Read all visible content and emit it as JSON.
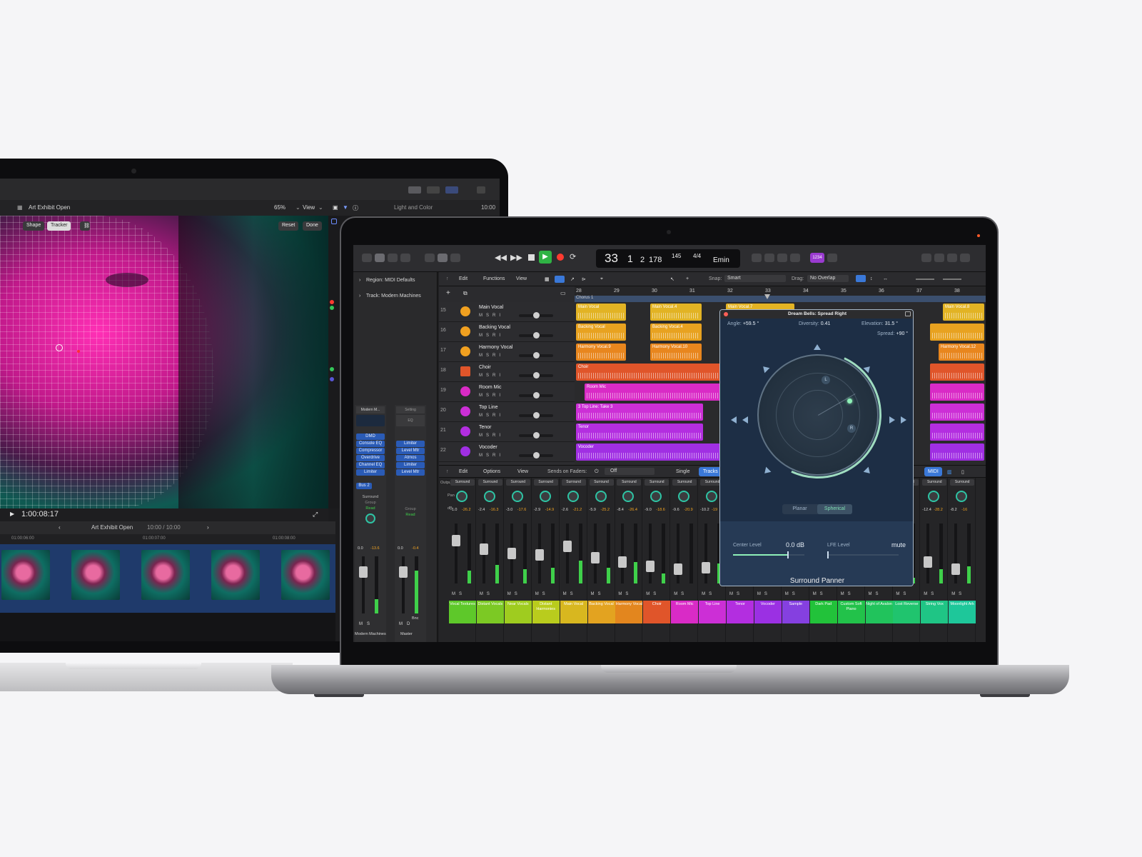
{
  "final_cut": {
    "project_title": "Art Exhibit Open",
    "zoom": "65%",
    "view_menu": "View",
    "inspector_title": "Light and Color",
    "inspector_time": "10:00",
    "shape_tab": "Shape",
    "tracker_tab": "Tracker",
    "reset_button": "Reset",
    "done_button": "Done",
    "timecode": "1:00:08:17",
    "timeline_project": "Art Exhibit Open",
    "timeline_duration": "10:00 / 10:00",
    "ruler_marks": [
      "01:00:06:00",
      "01:00:07:00",
      "01:00:08:00"
    ]
  },
  "logic": {
    "lcd": {
      "bar": "33",
      "beat": "1",
      "div": "2",
      "tick": "178",
      "tempo": "145",
      "signature": "4/4",
      "key": "Emin"
    },
    "cpu_badge": "1234",
    "inspector": {
      "region": "Region: MIDI Defaults",
      "track": "Track: Modern Machines"
    },
    "tracks_menu": {
      "edit": "Edit",
      "functions": "Functions",
      "view": "View",
      "snap_label": "Snap:",
      "snap_value": "Smart",
      "drag_label": "Drag:",
      "drag_value": "No Overlap"
    },
    "ruler": [
      "28",
      "29",
      "30",
      "31",
      "32",
      "33",
      "34",
      "35",
      "36",
      "37",
      "38"
    ],
    "marker": "Chorus 1",
    "tracks": [
      {
        "num": "15",
        "name": "Main Vocal"
      },
      {
        "num": "16",
        "name": "Backing Vocal"
      },
      {
        "num": "17",
        "name": "Harmony Vocal"
      },
      {
        "num": "18",
        "name": "Choir"
      },
      {
        "num": "19",
        "name": "Room Mic"
      },
      {
        "num": "20",
        "name": "Top Line"
      },
      {
        "num": "21",
        "name": "Tenor"
      },
      {
        "num": "22",
        "name": "Vocoder"
      }
    ],
    "regions": [
      {
        "label": "Main Vocal",
        "color": "#e2b324"
      },
      {
        "label": "Main Vocal.4",
        "color": "#e2b324"
      },
      {
        "label": "Main Vocal.7",
        "color": "#e2b324"
      },
      {
        "label": "Main Vocal.8",
        "color": "#e2b324"
      },
      {
        "label": "Backing Vocal",
        "color": "#e8a220"
      },
      {
        "label": "Backing Vocal.4",
        "color": "#e8a220"
      },
      {
        "label": "Harmony Vocal.9",
        "color": "#e8861e"
      },
      {
        "label": "Harmony Vocal.10",
        "color": "#e8861e"
      },
      {
        "label": "Harmony Vocal.12",
        "color": "#e8861e"
      },
      {
        "label": "Choir",
        "color": "#e0552a"
      },
      {
        "label": "Room Mic",
        "color": "#d92bc6"
      },
      {
        "label": "3  Top Line: Take 3",
        "color": "#cc2fd6"
      },
      {
        "label": "Tenor",
        "color": "#b32ee0"
      },
      {
        "label": "Vocoder",
        "color": "#a02fe3"
      }
    ],
    "strip_plugins_left": [
      "DMD",
      "Console EQ",
      "Compressor",
      "Overdrive",
      "Channel EQ",
      "Limiter"
    ],
    "strip_plugins_right": [
      "Limiter",
      "Level Mtr",
      "Atmos",
      "Limiter",
      "Level Mtr"
    ],
    "strip_labels": {
      "left_name": "Modern M...",
      "setting": "Setting",
      "eq": "EQ",
      "bus": "Bus 2",
      "surround": "Surround",
      "group": "Group",
      "read": "Read",
      "left_vol": "0.0",
      "left_peak": "-13.6",
      "right_vol": "0.0",
      "right_peak": "-0.4",
      "bnc": "Bnc",
      "channel_left": "Modern Machines",
      "channel_right": "Master"
    },
    "mixer_menu": {
      "edit": "Edit",
      "options": "Options",
      "view": "View",
      "sends": "Sends on Faders:",
      "sends_value": "Off",
      "single": "Single",
      "tracks": "Tracks",
      "midi": "MIDI",
      "output_label": "Output",
      "pan_label": "Pan",
      "db_label": "dB"
    },
    "channels": [
      {
        "name": "Vocal Textures",
        "color": "#5ec82a",
        "vol": "-1.0",
        "peak": "-26.2"
      },
      {
        "name": "Distant Vocals",
        "color": "#7cc924",
        "vol": "-2.4",
        "peak": "-16.3"
      },
      {
        "name": "Near Vocals",
        "color": "#9fcc1f",
        "vol": "-3.0",
        "peak": "-17.6"
      },
      {
        "name": "Distant Harmonies",
        "color": "#b9cc1d",
        "vol": "-2.9",
        "peak": "-14.9"
      },
      {
        "name": "Main Vocal",
        "color": "#d8b71f",
        "vol": "-2.6",
        "peak": "-21.2"
      },
      {
        "name": "Backing Vocal",
        "color": "#e3a320",
        "vol": "-5.9",
        "peak": "-25.2"
      },
      {
        "name": "Harmony Vocal",
        "color": "#e3861e",
        "vol": "-8.4",
        "peak": "-26.4"
      },
      {
        "name": "Choir",
        "color": "#e0552a",
        "vol": "-9.0",
        "peak": "-18.6"
      },
      {
        "name": "Room Mic",
        "color": "#d92bc6",
        "vol": "-9.6",
        "peak": "-20.9"
      },
      {
        "name": "Top Line",
        "color": "#cc2fd6",
        "vol": "-10.2",
        "peak": "-19"
      },
      {
        "name": "Tenor",
        "color": "#b32ee0",
        "vol": "",
        "peak": ""
      },
      {
        "name": "Vocoder",
        "color": "#9b30e3",
        "vol": "",
        "peak": ""
      },
      {
        "name": "Sample",
        "color": "#8540e0",
        "vol": "",
        "peak": ""
      },
      {
        "name": "Dark Pad",
        "color": "#22c23a",
        "vol": "",
        "peak": ""
      },
      {
        "name": "Custom Soft Piano",
        "color": "#22c24a",
        "vol": "",
        "peak": ""
      },
      {
        "name": "Night of Avalon",
        "color": "#21c35c",
        "vol": "",
        "peak": ""
      },
      {
        "name": "Lost Reverse",
        "color": "#20c46e",
        "vol": "",
        "peak": ""
      },
      {
        "name": "String Vox",
        "color": "#1fc585",
        "vol": "-12.4",
        "peak": "-28.2"
      },
      {
        "name": "Moonlight Ark",
        "color": "#1ec79a",
        "vol": "-8.2",
        "peak": "-16"
      }
    ],
    "surround_panner": {
      "title": "Dream Bells: Spread Right",
      "angle_label": "Angle:",
      "angle": "+59.5 °",
      "diversity_label": "Diversity:",
      "diversity": "0.41",
      "elevation_label": "Elevation:",
      "elevation": "31.5 °",
      "spread_label": "Spread:",
      "spread": "+90 °",
      "mode_planar": "Planar",
      "mode_spherical": "Spherical",
      "center_level_label": "Center Level",
      "center_level": "0.0 dB",
      "lfe_level_label": "LFE Level",
      "lfe_level": "mute",
      "name": "Surround Panner",
      "speaker_l": "L",
      "speaker_r": "R"
    }
  }
}
